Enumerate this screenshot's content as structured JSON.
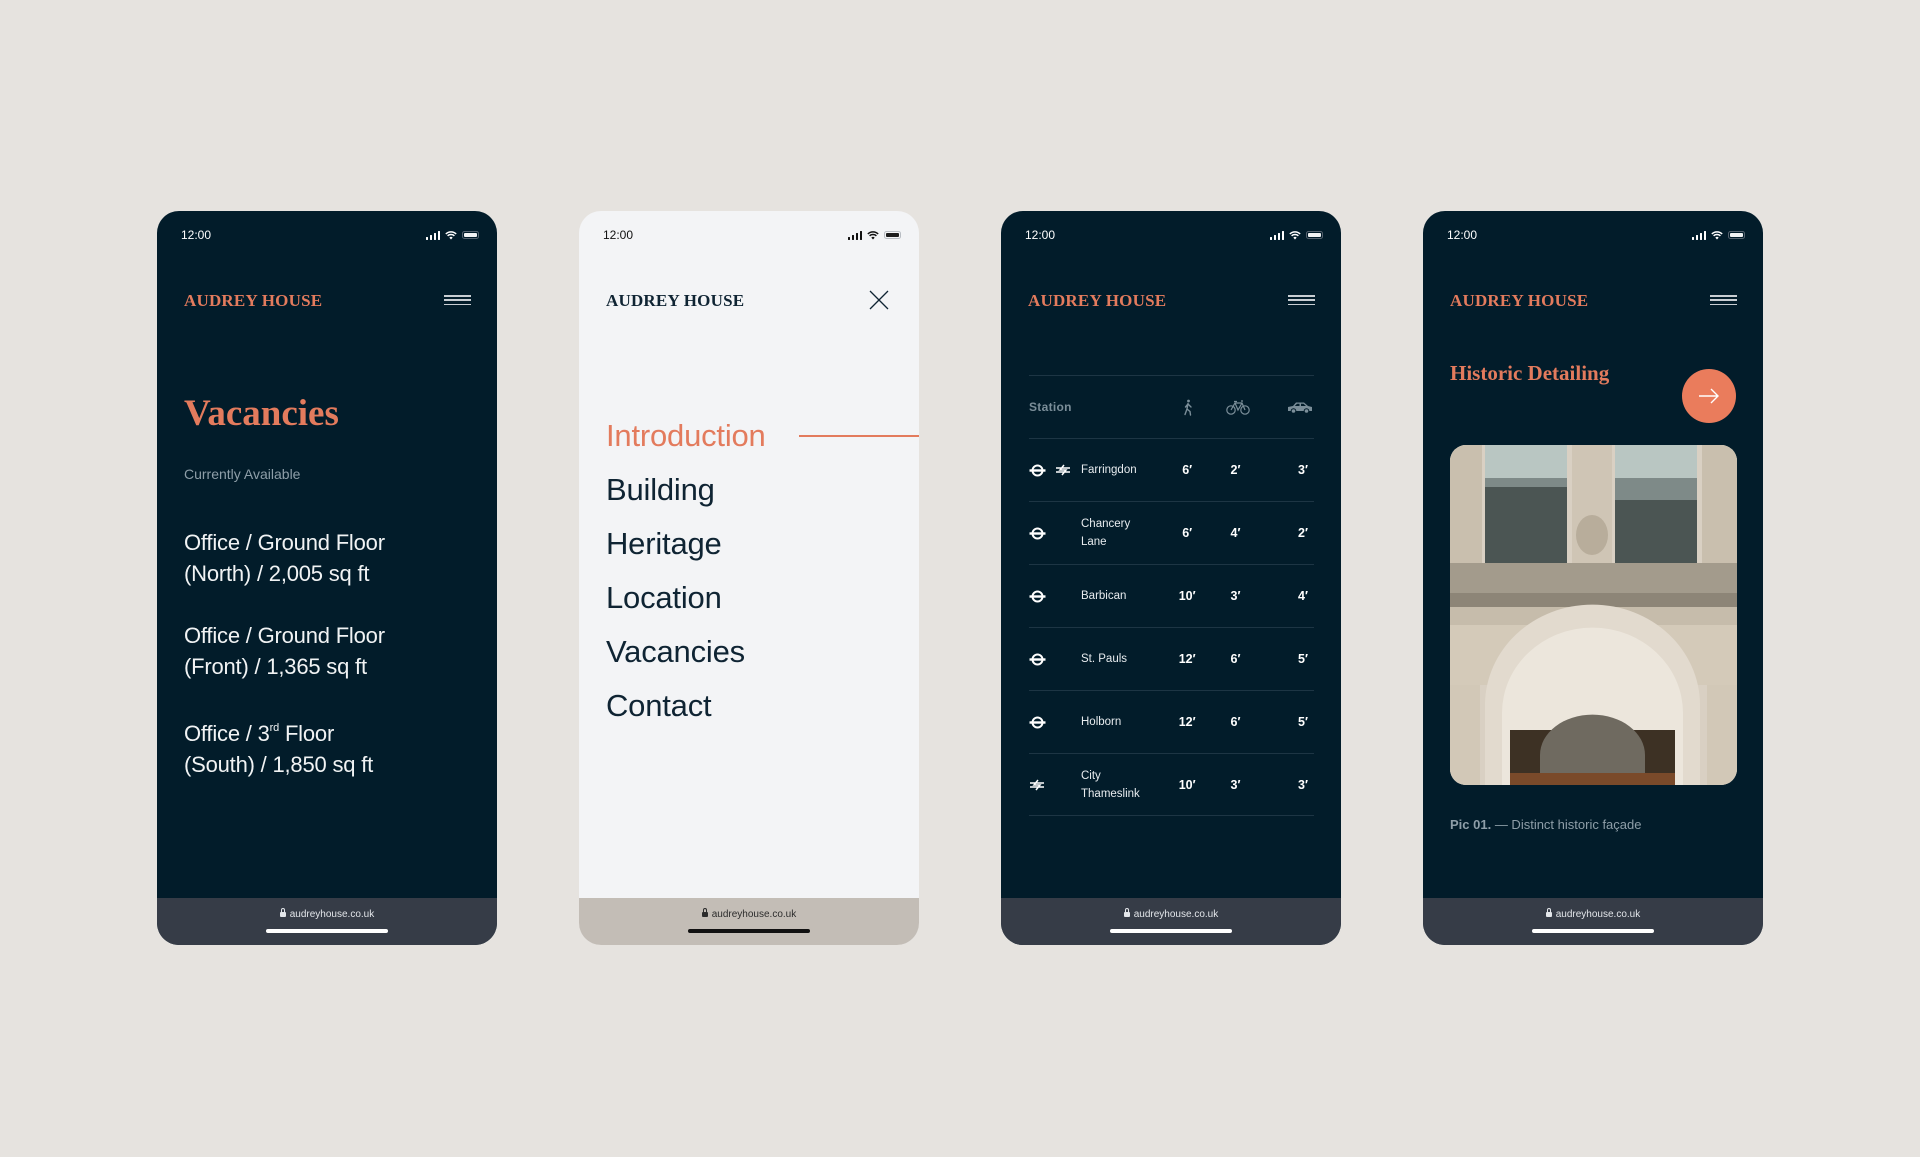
{
  "colors": {
    "background": "#e6e3df",
    "dark_screen": "#021c2a",
    "light_screen": "#f3f4f6",
    "accent": "#e37b5d",
    "navy_text": "#0f2433"
  },
  "common": {
    "status_time": "12:00",
    "brand": "AUDREY HOUSE",
    "url": "audreyhouse.co.uk",
    "icons": {
      "signal": "signal-icon",
      "wifi": "wifi-icon",
      "battery": "battery-icon",
      "menu": "hamburger-menu-icon",
      "lock": "lock-icon"
    }
  },
  "vacancies_screen": {
    "title": "Vacancies",
    "subtitle": "Currently Available",
    "items": [
      {
        "line1": "Office / Ground Floor",
        "line2": "(North) / 2,005 sq ft"
      },
      {
        "line1": "Office / Ground Floor",
        "line2": "(Front) / 1,365 sq ft"
      },
      {
        "line1_prefix": "Office / 3",
        "line1_sup": "rd",
        "line1_suffix": " Floor",
        "line2": "(South) / 1,850 sq ft"
      }
    ]
  },
  "menu_screen": {
    "close_icon": "close-icon",
    "items": [
      {
        "label": "Introduction",
        "active": true
      },
      {
        "label": "Building",
        "active": false
      },
      {
        "label": "Heritage",
        "active": false
      },
      {
        "label": "Location",
        "active": false
      },
      {
        "label": "Vacancies",
        "active": false
      },
      {
        "label": "Contact",
        "active": false
      }
    ]
  },
  "location_screen": {
    "header": {
      "station": "Station",
      "walk_icon": "walking-icon",
      "bike_icon": "bicycle-icon",
      "car_icon": "car-icon"
    },
    "rows": [
      {
        "name": "Farringdon",
        "modes": [
          "underground",
          "national-rail"
        ],
        "walk": "6′",
        "bike": "2′",
        "car": "3′"
      },
      {
        "name": "Chancery Lane",
        "modes": [
          "underground"
        ],
        "walk": "6′",
        "bike": "4′",
        "car": "2′"
      },
      {
        "name": "Barbican",
        "modes": [
          "underground"
        ],
        "walk": "10′",
        "bike": "3′",
        "car": "4′"
      },
      {
        "name": "St. Pauls",
        "modes": [
          "underground"
        ],
        "walk": "12′",
        "bike": "6′",
        "car": "5′"
      },
      {
        "name": "Holborn",
        "modes": [
          "underground"
        ],
        "walk": "12′",
        "bike": "6′",
        "car": "5′"
      },
      {
        "name": "City Thameslink",
        "modes": [
          "national-rail"
        ],
        "walk": "10′",
        "bike": "3′",
        "car": "3′"
      }
    ]
  },
  "heritage_screen": {
    "title": "Historic Detailing",
    "arrow_icon": "arrow-right-icon",
    "photo_alt": "Ornate historic stone façade with arched entrance",
    "caption_label": "Pic 01.",
    "caption_text": " — Distinct historic façade"
  }
}
